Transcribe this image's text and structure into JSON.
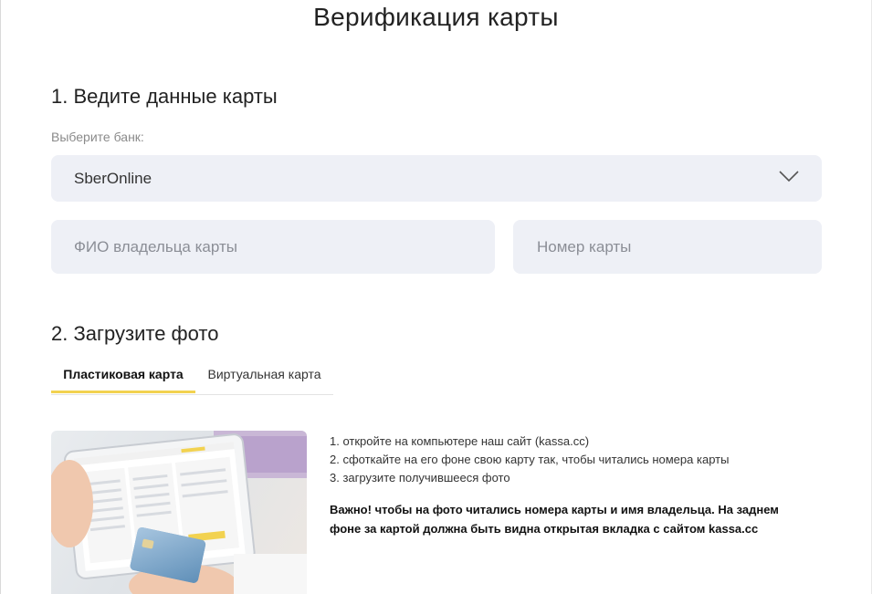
{
  "page": {
    "title": "Верификация карты"
  },
  "step1": {
    "title": "1. Ведите данные карты",
    "bank_label": "Выберите банк:",
    "bank_selected": "SberOnline",
    "name_placeholder": "ФИО владельца карты",
    "card_placeholder": "Номер карты"
  },
  "step2": {
    "title": "2. Загрузите фото",
    "tabs": [
      {
        "label": "Пластиковая карта",
        "active": true
      },
      {
        "label": "Виртуальная карта",
        "active": false
      }
    ],
    "instructions": [
      "1. откройте на компьютере наш сайт (kassa.cc)",
      "2. сфоткайте на его фоне свою карту так, чтобы читались номера карты",
      "3. загрузите получившееся фото"
    ],
    "important_lines": [
      "Важно! чтобы на фото читались номера карты и имя владельца. На заднем",
      "фоне за картой должна быть видна открытая вкладка с сайтом kassa.cc"
    ]
  },
  "colors": {
    "field_bg": "#eef0f6",
    "tab_accent": "#f2d250",
    "placeholder": "#8b8e96"
  },
  "icons": {
    "select": "chevron-down-icon"
  }
}
